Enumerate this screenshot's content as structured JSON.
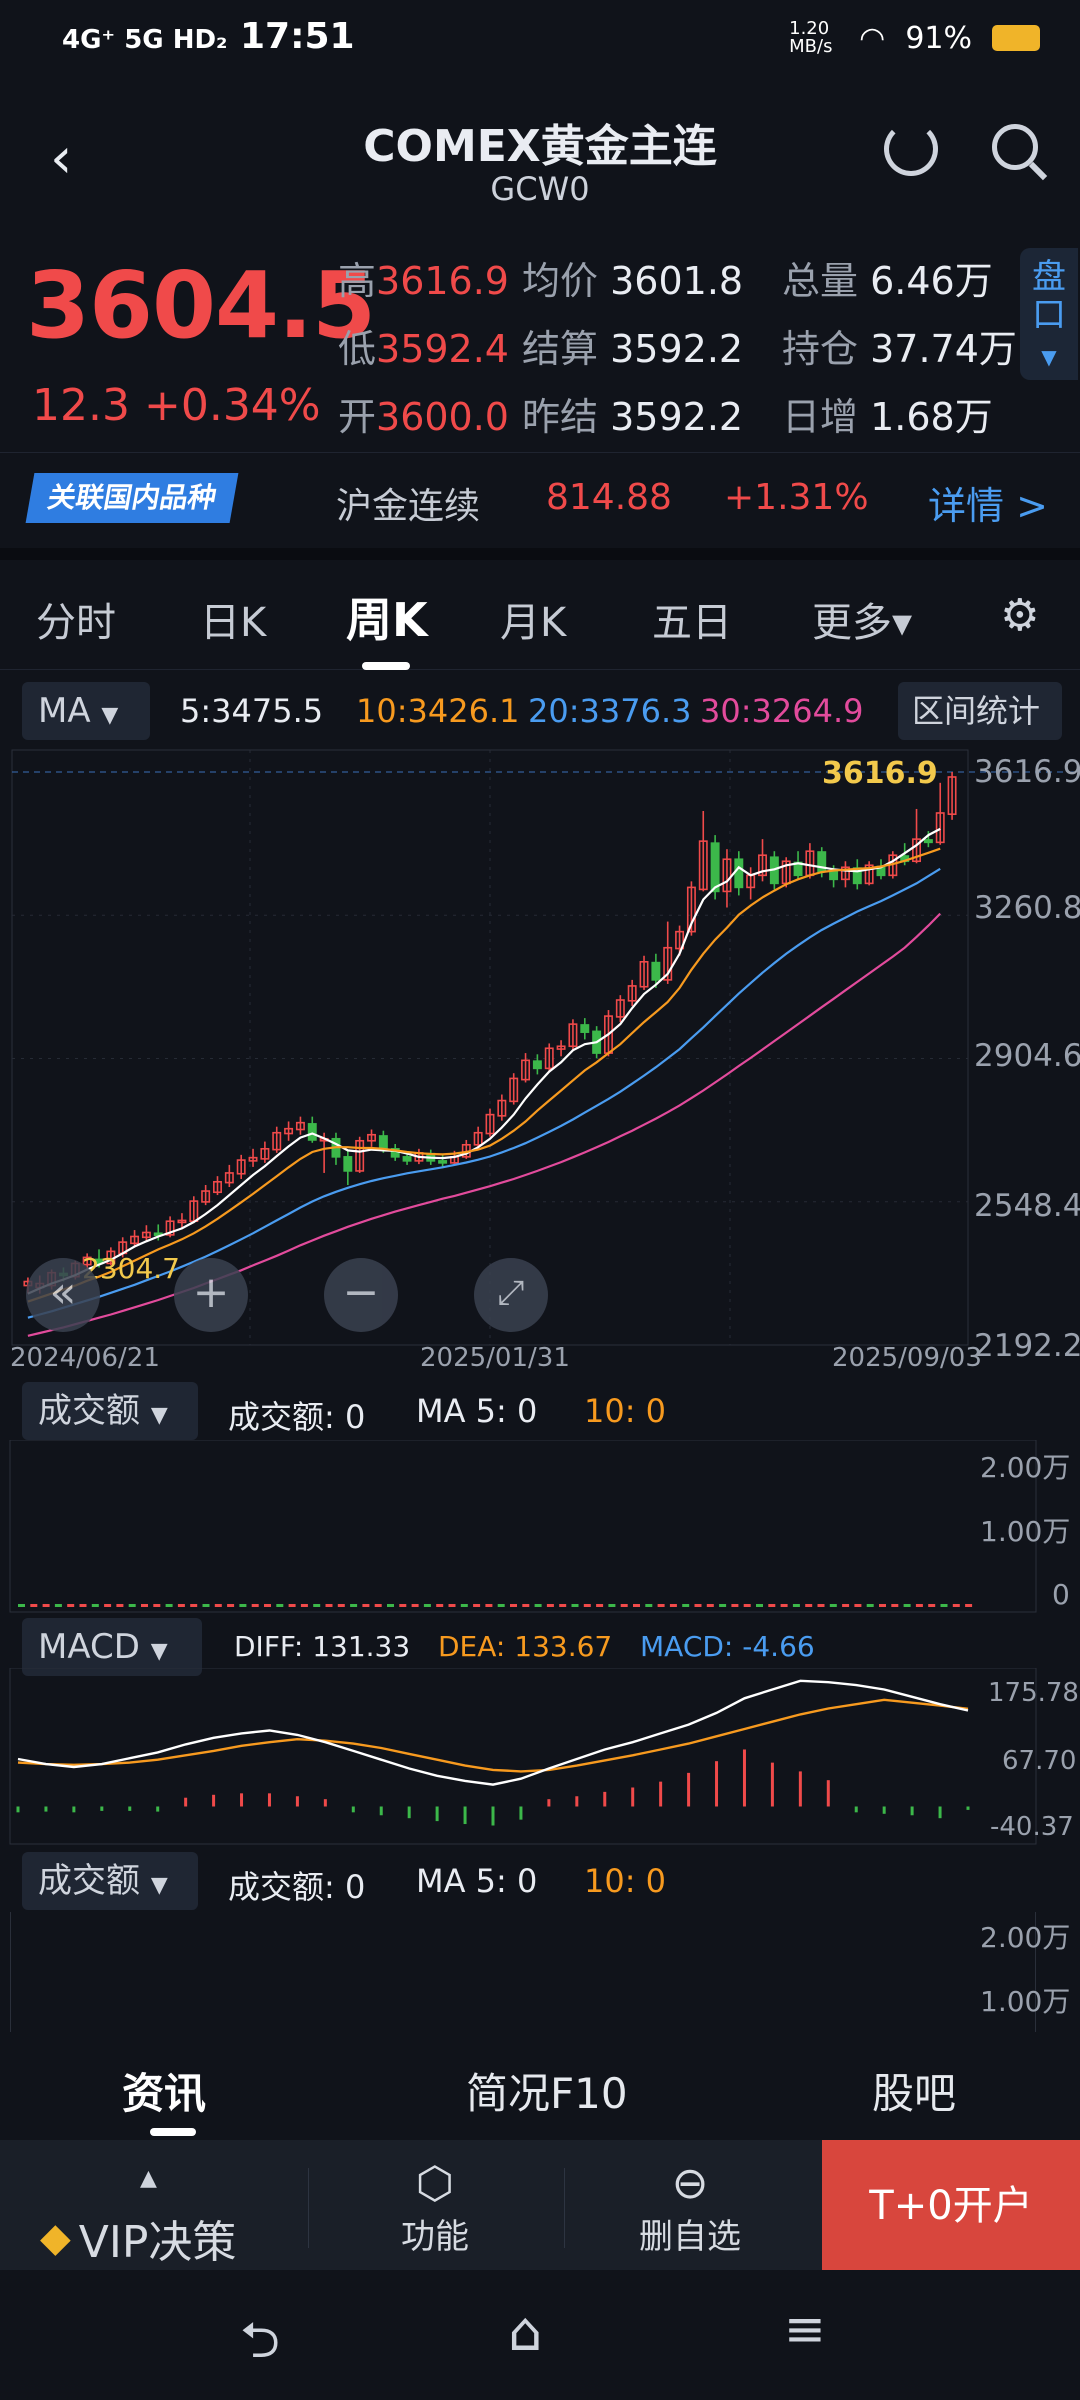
{
  "status": {
    "network": "4G⁺ 5G HD₂",
    "time": "17:51",
    "speed": "1.20 MB/s",
    "battery": "91%"
  },
  "header": {
    "title": "COMEX黄金主连",
    "code": "GCW0"
  },
  "quote": {
    "price": "3604.5",
    "change": "12.3",
    "change_pct": "+0.34%",
    "high_label": "高",
    "high": "3616.9",
    "low_label": "低",
    "low": "3592.4",
    "open_label": "开",
    "open": "3600.0",
    "avg_label": "均价",
    "avg": "3601.8",
    "settle_label": "结算",
    "settle": "3592.2",
    "prev_settle_label": "昨结",
    "prev_settle": "3592.2",
    "vol_label": "总量",
    "vol": "6.46万",
    "oi_label": "持仓",
    "oi": "37.74万",
    "daily_inc_label": "日增",
    "daily_inc": "1.68万",
    "side_button": "盘口"
  },
  "related": {
    "tag": "关联国内品种",
    "name": "沪金连续",
    "price": "814.88",
    "pct": "+1.31%",
    "detail": "详情 >"
  },
  "tabs": [
    "分时",
    "日K",
    "周K",
    "月K",
    "五日",
    "更多▾"
  ],
  "ma_bar": {
    "selector": "MA",
    "ma5": "5:3475.5",
    "ma10": "10:3426.1",
    "ma20": "20:3376.3",
    "ma30": "30:3264.9",
    "stats_button": "区间统计"
  },
  "kline": {
    "y_ticks": [
      "3616.9",
      "3260.8",
      "2904.6",
      "2548.4",
      "2192.2"
    ],
    "x_ticks": [
      "2024/06/21",
      "2025/01/31",
      "2025/09/03"
    ],
    "high_mark": "3616.9",
    "low_mark": "2304.7"
  },
  "vol_panel": {
    "selector": "成交额",
    "label": "成交额: 0",
    "ma5": "MA 5: 0",
    "ma10": "10: 0",
    "ticks": [
      "2.00万",
      "1.00万",
      "0"
    ]
  },
  "macd_panel": {
    "selector": "MACD",
    "diff": "DIFF: 131.33",
    "dea": "DEA: 133.67",
    "macd": "MACD: -4.66",
    "ticks": [
      "175.78",
      "67.70",
      "-40.37"
    ]
  },
  "vol_panel2": {
    "selector": "成交额",
    "label": "成交额: 0",
    "ma5": "MA 5: 0",
    "ma10": "10: 0",
    "ticks": [
      "2.00万",
      "1.00万"
    ]
  },
  "bottom_tabs": [
    "资讯",
    "简况F10",
    "股吧"
  ],
  "toolbar": {
    "vip": "VIP决策",
    "func": "功能",
    "delete": "删自选",
    "open": "T+0开户"
  },
  "colors": {
    "up": "#f04a4a",
    "down": "#3cb84a",
    "ma5": "#ffffff",
    "ma10": "#f79a1f",
    "ma20": "#4a9cf0",
    "ma30": "#e24b9c",
    "accent": "#2f7de1"
  },
  "chart_data": {
    "type": "candlestick",
    "x_range": [
      "2024/06/21",
      "2025/09/03"
    ],
    "ylim": [
      2192.2,
      3616.9
    ],
    "series": [
      {
        "name": "K",
        "ohlc": [
          [
            2340,
            2350,
            2320,
            2360
          ],
          [
            2335,
            2345,
            2320,
            2365
          ],
          [
            2340,
            2372,
            2330,
            2380
          ],
          [
            2370,
            2365,
            2350,
            2385
          ],
          [
            2362,
            2395,
            2355,
            2402
          ],
          [
            2392,
            2410,
            2380,
            2420
          ],
          [
            2405,
            2395,
            2385,
            2430
          ],
          [
            2395,
            2425,
            2390,
            2435
          ],
          [
            2420,
            2448,
            2410,
            2460
          ],
          [
            2445,
            2462,
            2435,
            2478
          ],
          [
            2460,
            2472,
            2450,
            2490
          ],
          [
            2470,
            2468,
            2452,
            2492
          ],
          [
            2466,
            2500,
            2460,
            2512
          ],
          [
            2498,
            2502,
            2480,
            2520
          ],
          [
            2500,
            2550,
            2495,
            2562
          ],
          [
            2548,
            2575,
            2540,
            2590
          ],
          [
            2572,
            2598,
            2565,
            2612
          ],
          [
            2596,
            2620,
            2585,
            2640
          ],
          [
            2618,
            2652,
            2605,
            2665
          ],
          [
            2650,
            2658,
            2635,
            2680
          ],
          [
            2655,
            2680,
            2645,
            2698
          ],
          [
            2678,
            2720,
            2670,
            2735
          ],
          [
            2718,
            2730,
            2700,
            2748
          ],
          [
            2728,
            2745,
            2715,
            2760
          ],
          [
            2742,
            2702,
            2695,
            2760
          ],
          [
            2700,
            2705,
            2620,
            2720
          ],
          [
            2705,
            2660,
            2640,
            2720
          ],
          [
            2660,
            2625,
            2590,
            2675
          ],
          [
            2625,
            2700,
            2620,
            2710
          ],
          [
            2700,
            2715,
            2685,
            2728
          ],
          [
            2712,
            2680,
            2670,
            2725
          ],
          [
            2680,
            2660,
            2650,
            2692
          ],
          [
            2660,
            2650,
            2640,
            2672
          ],
          [
            2650,
            2670,
            2642,
            2680
          ],
          [
            2668,
            2650,
            2640,
            2678
          ],
          [
            2650,
            2645,
            2632,
            2665
          ],
          [
            2645,
            2660,
            2640,
            2675
          ],
          [
            2660,
            2690,
            2655,
            2702
          ],
          [
            2690,
            2720,
            2680,
            2735
          ],
          [
            2718,
            2765,
            2710,
            2780
          ],
          [
            2762,
            2800,
            2750,
            2815
          ],
          [
            2798,
            2855,
            2790,
            2868
          ],
          [
            2852,
            2900,
            2845,
            2918
          ],
          [
            2898,
            2880,
            2865,
            2915
          ],
          [
            2880,
            2930,
            2870,
            2942
          ],
          [
            2928,
            2935,
            2910,
            2950
          ],
          [
            2935,
            2990,
            2925,
            3002
          ],
          [
            2988,
            2970,
            2952,
            3005
          ],
          [
            2972,
            2918,
            2905,
            2985
          ],
          [
            2918,
            3010,
            2910,
            3025
          ],
          [
            3008,
            3050,
            2995,
            3062
          ],
          [
            3048,
            3085,
            3035,
            3100
          ],
          [
            3083,
            3145,
            3075,
            3160
          ],
          [
            3143,
            3100,
            3080,
            3165
          ],
          [
            3100,
            3180,
            3090,
            3245
          ],
          [
            3178,
            3220,
            3160,
            3235
          ],
          [
            3220,
            3330,
            3210,
            3345
          ],
          [
            3325,
            3445,
            3320,
            3520
          ],
          [
            3440,
            3320,
            3300,
            3460
          ],
          [
            3320,
            3400,
            3280,
            3425
          ],
          [
            3400,
            3330,
            3310,
            3420
          ],
          [
            3330,
            3360,
            3300,
            3380
          ],
          [
            3360,
            3410,
            3345,
            3450
          ],
          [
            3405,
            3340,
            3325,
            3420
          ],
          [
            3340,
            3395,
            3330,
            3405
          ],
          [
            3392,
            3360,
            3350,
            3420
          ],
          [
            3360,
            3420,
            3352,
            3440
          ],
          [
            3418,
            3370,
            3355,
            3430
          ],
          [
            3370,
            3350,
            3330,
            3385
          ],
          [
            3350,
            3380,
            3330,
            3395
          ],
          [
            3378,
            3340,
            3325,
            3400
          ],
          [
            3340,
            3385,
            3335,
            3395
          ],
          [
            3382,
            3360,
            3350,
            3400
          ],
          [
            3360,
            3410,
            3352,
            3420
          ],
          [
            3408,
            3395,
            3385,
            3440
          ],
          [
            3395,
            3450,
            3390,
            3525
          ],
          [
            3448,
            3442,
            3430,
            3470
          ],
          [
            3442,
            3515,
            3436,
            3590
          ],
          [
            3512,
            3604.5,
            3498,
            3616.9
          ]
        ]
      },
      {
        "name": "MA5",
        "values": [
          2320,
          2333,
          2345,
          2355,
          2366,
          2380,
          2392,
          2404,
          2420,
          2437,
          2450,
          2462,
          2472,
          2482,
          2498,
          2518,
          2540,
          2565,
          2590,
          2615,
          2637,
          2662,
          2686,
          2708,
          2718,
          2706,
          2692,
          2676,
          2673,
          2678,
          2676,
          2675,
          2668,
          2660,
          2658,
          2657,
          2660,
          2668,
          2684,
          2705,
          2733,
          2765,
          2805,
          2840,
          2872,
          2895,
          2925,
          2940,
          2945,
          2965,
          2990,
          3030,
          3065,
          3088,
          3115,
          3165,
          3240,
          3300,
          3330,
          3345,
          3380,
          3360,
          3370,
          3375,
          3385,
          3390,
          3385,
          3380,
          3375,
          3372,
          3370,
          3375,
          3380,
          3395,
          3415,
          3435,
          3460,
          3475.5
        ]
      },
      {
        "name": "MA10",
        "values": [
          2300,
          2310,
          2320,
          2330,
          2340,
          2352,
          2362,
          2374,
          2388,
          2402,
          2416,
          2430,
          2442,
          2455,
          2470,
          2487,
          2506,
          2526,
          2547,
          2568,
          2590,
          2612,
          2634,
          2655,
          2672,
          2680,
          2684,
          2684,
          2682,
          2682,
          2680,
          2676,
          2672,
          2669,
          2667,
          2666,
          2668,
          2672,
          2678,
          2688,
          2705,
          2725,
          2748,
          2775,
          2800,
          2825,
          2850,
          2875,
          2895,
          2918,
          2940,
          2968,
          2995,
          3020,
          3045,
          3080,
          3125,
          3165,
          3200,
          3230,
          3262,
          3285,
          3305,
          3322,
          3338,
          3350,
          3360,
          3368,
          3372,
          3374,
          3376,
          3378,
          3382,
          3388,
          3396,
          3406,
          3416,
          3426.1
        ]
      },
      {
        "name": "MA20",
        "values": [
          2260,
          2268,
          2276,
          2285,
          2294,
          2303,
          2312,
          2322,
          2332,
          2342,
          2353,
          2364,
          2375,
          2387,
          2399,
          2412,
          2426,
          2440,
          2455,
          2470,
          2486,
          2502,
          2518,
          2534,
          2549,
          2562,
          2573,
          2583,
          2592,
          2600,
          2607,
          2613,
          2619,
          2624,
          2629,
          2634,
          2640,
          2646,
          2653,
          2661,
          2671,
          2682,
          2694,
          2708,
          2722,
          2737,
          2753,
          2770,
          2787,
          2804,
          2822,
          2842,
          2862,
          2883,
          2905,
          2928,
          2955,
          2982,
          3010,
          3038,
          3066,
          3092,
          3118,
          3142,
          3165,
          3186,
          3206,
          3224,
          3240,
          3255,
          3270,
          3283,
          3296,
          3310,
          3325,
          3340,
          3358,
          3376.3
        ]
      },
      {
        "name": "MA30",
        "values": [
          2215,
          2222,
          2229,
          2236,
          2244,
          2252,
          2260,
          2268,
          2277,
          2286,
          2295,
          2304,
          2314,
          2324,
          2334,
          2345,
          2356,
          2367,
          2378,
          2390,
          2402,
          2414,
          2427,
          2440,
          2452,
          2464,
          2475,
          2486,
          2496,
          2506,
          2515,
          2524,
          2532,
          2540,
          2548,
          2556,
          2563,
          2571,
          2579,
          2587,
          2596,
          2605,
          2615,
          2625,
          2636,
          2647,
          2659,
          2671,
          2684,
          2697,
          2711,
          2725,
          2740,
          2755,
          2771,
          2788,
          2806,
          2825,
          2845,
          2865,
          2886,
          2906,
          2927,
          2948,
          2969,
          2990,
          3011,
          3032,
          3053,
          3074,
          3095,
          3116,
          3137,
          3158,
          3180,
          3207,
          3235,
          3264.9
        ]
      }
    ],
    "macd": {
      "diff": [
        65,
        58,
        54,
        58,
        66,
        74,
        85,
        94,
        100,
        104,
        98,
        88,
        76,
        64,
        52,
        42,
        35,
        30,
        38,
        52,
        65,
        78,
        88,
        100,
        112,
        128,
        148,
        160,
        172,
        170,
        166,
        160,
        150,
        140,
        131.33
      ],
      "dea": [
        60,
        58,
        57,
        58,
        60,
        64,
        70,
        76,
        83,
        88,
        92,
        90,
        86,
        80,
        72,
        64,
        56,
        50,
        48,
        50,
        56,
        63,
        70,
        78,
        86,
        96,
        106,
        116,
        126,
        134,
        140,
        146,
        142,
        138,
        133.67
      ],
      "hist": [
        -8,
        -7,
        -8,
        -6,
        -6,
        -7,
        12,
        16,
        18,
        18,
        14,
        10,
        -8,
        -12,
        -16,
        -20,
        -24,
        -26,
        -18,
        10,
        14,
        20,
        26,
        34,
        46,
        62,
        78,
        60,
        48,
        36,
        -8,
        -10,
        -12,
        -16,
        -4.66
      ],
      "ylim": [
        -40.37,
        175.78
      ]
    }
  }
}
